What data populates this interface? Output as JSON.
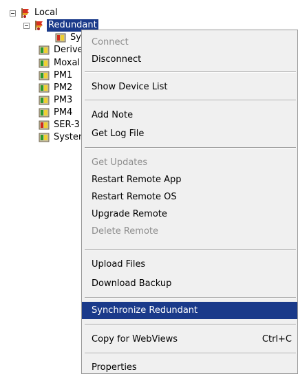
{
  "tree": {
    "root": {
      "label": "Local",
      "icon": "flag-red-icon"
    },
    "redundant": {
      "label": "Redundant",
      "label_visible": "Redun",
      "icon": "flag-red-icon"
    },
    "items": [
      {
        "label": "Sy",
        "icon": "red-device-icon"
      },
      {
        "label": "Derive",
        "icon": "green-device-icon"
      },
      {
        "label": "Moxal",
        "icon": "green-device-icon"
      },
      {
        "label": "PM1",
        "icon": "green-device-icon"
      },
      {
        "label": "PM2",
        "icon": "green-device-icon"
      },
      {
        "label": "PM3",
        "icon": "green-device-icon"
      },
      {
        "label": "PM4",
        "icon": "green-device-icon"
      },
      {
        "label": "SER-3",
        "icon": "red-device-icon"
      },
      {
        "label": "Syster",
        "icon": "green-device-icon"
      }
    ]
  },
  "context_menu": {
    "connect": "Connect",
    "disconnect": "Disconnect",
    "show_device_list": "Show Device List",
    "add_note": "Add Note",
    "get_log_file": "Get Log File",
    "get_updates": "Get Updates",
    "restart_remote_app": "Restart Remote App",
    "restart_remote_os": "Restart Remote OS",
    "upgrade_remote": "Upgrade Remote",
    "delete_remote": "Delete Remote",
    "upload_files": "Upload Files",
    "download_backup": "Download Backup",
    "synchronize_redundant": "Synchronize Redundant",
    "copy_for_webviews": "Copy for WebViews",
    "copy_shortcut": "Ctrl+C",
    "properties": "Properties"
  },
  "colors": {
    "selection": "#1a3a8a",
    "menu_bg": "#f0f0f0",
    "disabled_text": "#8d8d8d"
  }
}
